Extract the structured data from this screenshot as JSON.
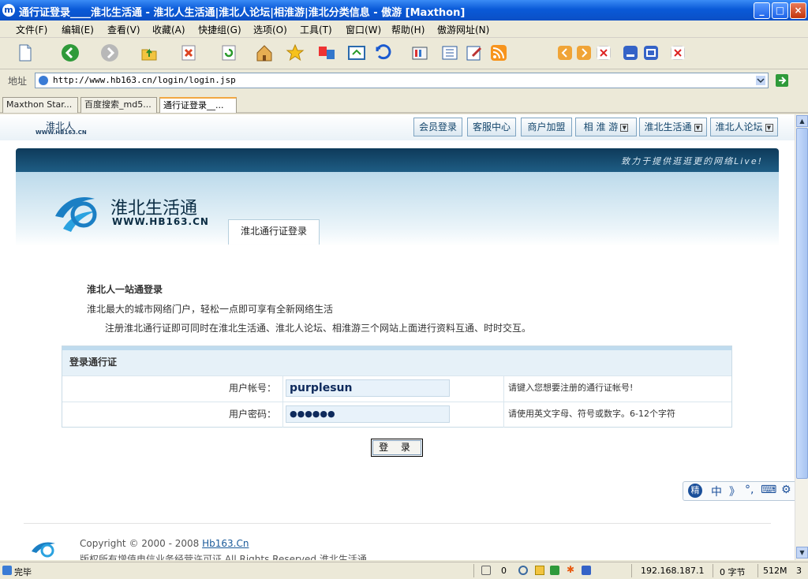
{
  "window": {
    "title": "通行证登录____淮北生活通 - 淮北人生活通|淮北人论坛|相淮游|淮北分类信息 - 傲游 [Maxthon]",
    "app_icon_letter": "m",
    "controls": [
      "_",
      "□",
      "×"
    ]
  },
  "menu": [
    "文件(F)",
    "编辑(E)",
    "查看(V)",
    "收藏(A)",
    "快捷组(G)",
    "选项(O)",
    "工具(T)",
    "窗口(W)",
    "帮助(H)",
    "傲游网址(N)"
  ],
  "address": {
    "label": "地址",
    "url": "http://www.hb163.cn/login/login.jsp"
  },
  "tabs": [
    {
      "label": "Maxthon Star...",
      "active": false
    },
    {
      "label": "百度搜索_md5...",
      "active": false
    },
    {
      "label": "通行证登录__...",
      "active": true
    }
  ],
  "site": {
    "logo_small": "淮北人",
    "logo_small_domain": "WWW.HB163.CN",
    "nav": [
      {
        "label": "会员登录",
        "dropdown": false
      },
      {
        "label": "客服中心",
        "dropdown": false
      },
      {
        "label": "商户加盟",
        "dropdown": false
      },
      {
        "label": "相 淮 游",
        "dropdown": true
      },
      {
        "label": "淮北生活通",
        "dropdown": true
      },
      {
        "label": "淮北人论坛",
        "dropdown": true
      }
    ],
    "slogan": "致力于提供逛逛更的网络Live!",
    "brand_name": "淮北生活通",
    "brand_domain": "WWW.HB163.CN",
    "panel_tab": "淮北通行证登录",
    "intro_title": "淮北人一站通登录",
    "intro_line1": "淮北最大的城市网络门户，轻松一点即可享有全新网络生活",
    "intro_line2": "注册淮北通行证即可同时在淮北生活通、淮北人论坛、相淮游三个网站上面进行资料互通、时时交互。",
    "form": {
      "heading": "登录通行证",
      "username_label": "用户帐号：",
      "username_value": "purplesun",
      "username_hint": "请键入您想要注册的通行证帐号!",
      "password_label": "用户密码：",
      "password_value": "●●●●●●",
      "password_hint": "请使用英文字母、符号或数字。6-12个字符",
      "submit": "登 录"
    },
    "footer_copyright": "Copyright © 2000 - 2008 ",
    "footer_link": "Hb163.Cn",
    "footer_line2": "版权所有增值电信业务经营许可证  All Rights Reserved 淮北生活通"
  },
  "ime": [
    "精",
    "中",
    "》",
    "°,",
    "⌨",
    "⚙"
  ],
  "status": {
    "text": "完毕",
    "popup_count": "0",
    "ip": "192.168.187.1",
    "bytes": "0 字节",
    "memory": "512M",
    "tabs_count": "3"
  },
  "colors": {
    "titlebar": "#0a5ad8",
    "site_dark": "#0e3a5a",
    "accent_tab": "#f2a742"
  }
}
